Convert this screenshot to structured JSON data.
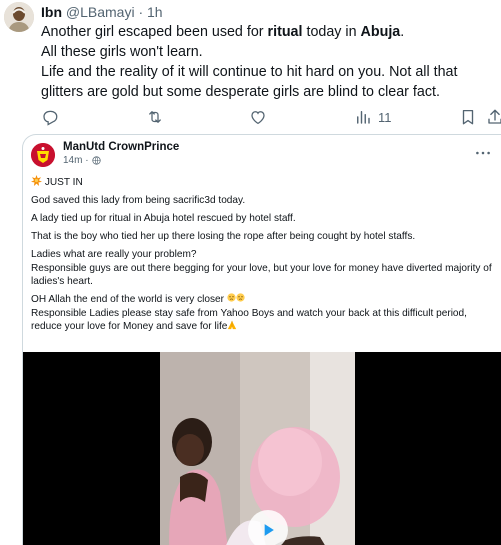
{
  "tweet": {
    "author_name": "Ibn",
    "handle": "@LBamayi",
    "time": "· 1h",
    "lines": [
      "Another girl escaped been used for ritual today in Abuja.",
      "All these girls won't learn.",
      " Life and the reality of it will continue to hit hard on you. Not all that glitters are gold but some desperate girls are blind to clear fact."
    ],
    "bold_words": [
      "ritual",
      "Abuja"
    ],
    "views": "11"
  },
  "quote": {
    "author_name": "ManUtd CrownPrince",
    "time": "14m ·",
    "badge": "JUST IN",
    "paragraphs": [
      "God saved this lady from being sacrific3d today.",
      "A lady tied up for ritual in Abuja hotel rescued by hotel staff.",
      "That is the boy who tied her up there losing the rope after being cought by hotel staffs.",
      "Ladies what are really your problem?",
      " Responsible guys are out there begging for your love, but your love for money have diverted majority of ladies's heart.",
      " OH Allah the end of the world is very closer",
      "Responsible Ladies please stay safe from Yahoo Boys and watch your back at this difficult period, reduce your love for Money and save for life"
    ]
  },
  "icons": {
    "reply": "reply-icon",
    "retweet": "retweet-icon",
    "like": "like-icon",
    "views": "views-icon",
    "bookmark": "bookmark-icon",
    "share": "share-icon",
    "more": "more-icon",
    "globe": "globe-icon",
    "play": "play-icon"
  },
  "colors": {
    "text": "#0f1419",
    "secondary": "#536471",
    "border": "#cfd9de",
    "badge_red": "#c8102e"
  }
}
